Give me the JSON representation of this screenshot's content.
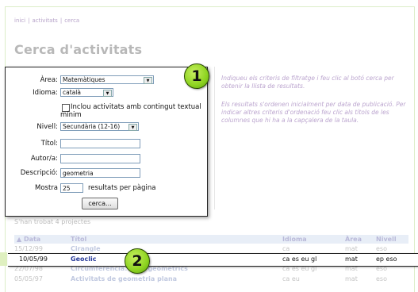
{
  "breadcrumb": {
    "inici": "inici",
    "activitats": "activitats",
    "cerca": "cerca",
    "sep": "|"
  },
  "page_title": "Cerca d'activitats",
  "help": {
    "p1": "Indiqueu els criteris de filtratge i feu clic al botó cerca per obtenir la llista de resultats.",
    "p2": "Els resultats s'ordenen inicialment per data de publicació. Per indicar altres criteris d'ordenació feu clic als títols de les columnes que hi ha a la capçalera de la taula."
  },
  "form": {
    "area_label": "Àrea:",
    "area_value": "Matemàtiques",
    "idioma_label": "Idioma:",
    "idioma_value": "català",
    "checkbox_label": "Inclou activitats amb contingut textual mínim",
    "nivell_label": "Nivell:",
    "nivell_value": "Secundària (12-16)",
    "titol_label": "Títol:",
    "titol_value": "",
    "autor_label": "Autor/a:",
    "autor_value": "",
    "descripcio_label": "Descripció:",
    "descripcio_value": "geometria",
    "mostra_label": "Mostra",
    "mostra_value": "25",
    "mostra_suffix": "resultats per pàgina",
    "search_button": "cerca..."
  },
  "markers": {
    "m1": "1",
    "m2": "2"
  },
  "results": {
    "count_text": "S'han trobat 4 projectes",
    "columns": {
      "data": "▲ Data",
      "titol": "Títol",
      "idioma": "Idioma",
      "area": "Àrea",
      "nivell": "Nivell"
    },
    "rows": [
      {
        "data": "15/12/99",
        "titol": "Cirangle",
        "idioma": "ca",
        "area": "mat",
        "nivell": "eso"
      },
      {
        "data": "10/05/99",
        "titol": "Geoclic",
        "idioma": "ca es eu gl",
        "area": "mat",
        "nivell": "ep eso"
      },
      {
        "data": "22/07/98",
        "titol": "Circumferència: llocs geomètrics",
        "idioma": "ca es eu gl",
        "area": "mat",
        "nivell": "eso"
      },
      {
        "data": "05/05/97",
        "titol": "Activitats de geometria plana",
        "idioma": "ca eu",
        "area": "mat",
        "nivell": "eso"
      }
    ]
  }
}
